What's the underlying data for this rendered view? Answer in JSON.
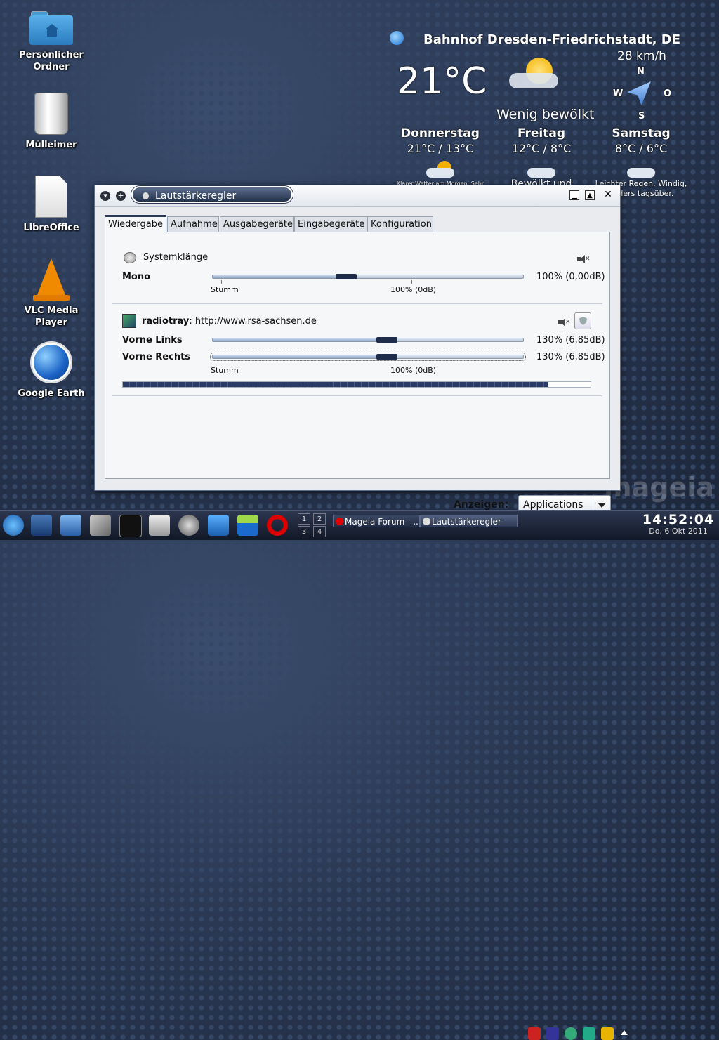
{
  "desktop": {
    "icons": [
      {
        "label": "Persönlicher Ordner",
        "icon": "home-folder-icon"
      },
      {
        "label": "Mülleimer",
        "icon": "trash-icon"
      },
      {
        "label": "LibreOffice",
        "icon": "libreoffice-icon"
      },
      {
        "label": "VLC Media Player",
        "icon": "vlc-icon"
      },
      {
        "label": "Google Earth",
        "icon": "google-earth-icon"
      }
    ],
    "watermark": "mageia"
  },
  "weather": {
    "station": "Bahnhof Dresden-Friedrichstadt, DE",
    "temperature": "21°C",
    "condition": "Wenig bewölkt",
    "wind_speed": "28 km/h",
    "compass": {
      "n": "N",
      "w": "W",
      "o": "O",
      "s": "S"
    },
    "forecast": [
      {
        "day": "Donnerstag",
        "temps": "21°C / 13°C",
        "text": "Klarer Wetter am Morgen, Sehr leichter"
      },
      {
        "day": "Freitag",
        "temps": "12°C / 8°C",
        "text": "Bewölkt und"
      },
      {
        "day": "Samstag",
        "temps": "8°C / 6°C",
        "text": "Leichter Regen. Windig, anders tagsüber."
      }
    ]
  },
  "window": {
    "title": "Lautstärkeregler",
    "tabs": [
      "Wiedergabe",
      "Aufnahme",
      "Ausgabegeräte",
      "Eingabegeräte",
      "Konfiguration"
    ],
    "active_tab": "Wiedergabe",
    "stream1": {
      "name": "Systemklänge",
      "channel": "Mono",
      "value": "100% (0,00dB)",
      "level": 0.43,
      "scale_min": "Stumm",
      "scale_mid": "100% (0dB)"
    },
    "stream2": {
      "app": "radiotray",
      "separator": ":",
      "url": "http://www.rsa-sachsen.de",
      "ch1": "Vorne Links",
      "ch1_value": "130% (6,85dB)",
      "ch1_level": 0.56,
      "ch2": "Vorne Rechts",
      "ch2_value": "130% (6,85dB)",
      "ch2_level": 0.56,
      "scale_min": "Stumm",
      "scale_mid": "100% (0dB)",
      "vu_level": 0.91
    },
    "show_label": "Anzeigen:",
    "show_value": "Applications"
  },
  "taskbar": {
    "tasks": [
      "Mageia Forum - ...",
      "Lautstärkeregler"
    ],
    "pager": [
      "1",
      "2",
      "3",
      "4"
    ],
    "time": "14:52:04",
    "date": "Do, 6 Okt 2011"
  },
  "colors": {
    "accent": "#2d3a55",
    "panel": "#f6f7f9",
    "taskbar": "#1f2940"
  }
}
